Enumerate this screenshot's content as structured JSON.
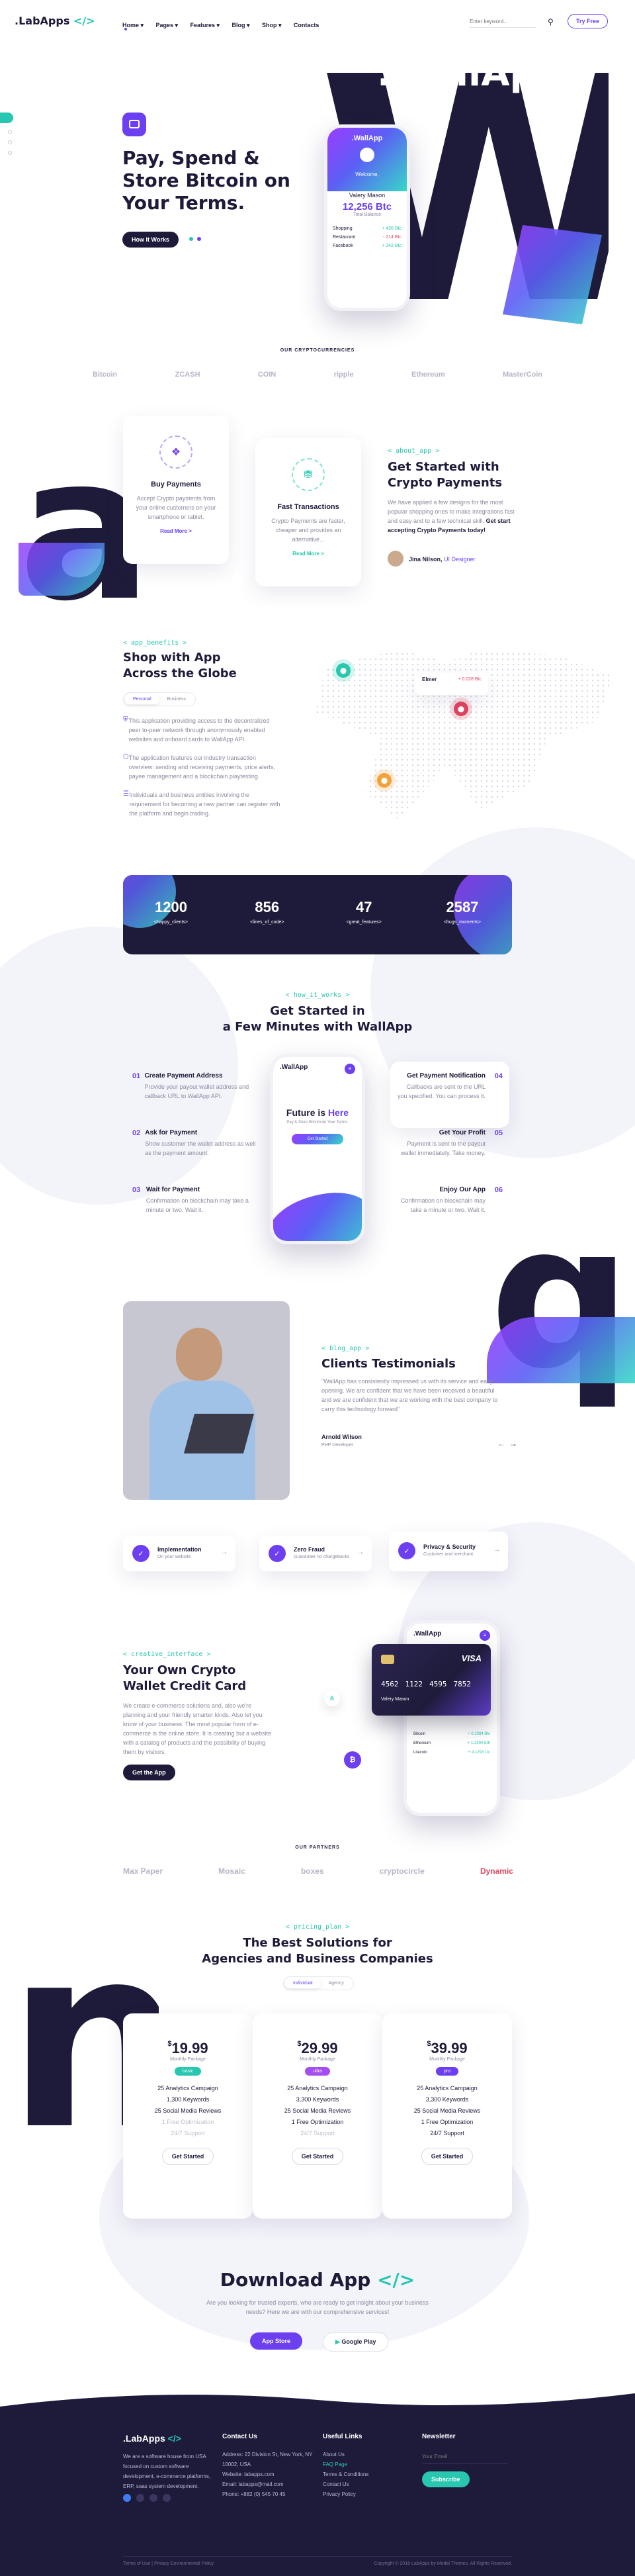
{
  "header": {
    "logo": ".LabApps",
    "logo_code": "</>",
    "nav": [
      "Home ▾",
      "Pages ▾",
      "Features ▾",
      "Blog ▾",
      "Shop ▾",
      "Contacts"
    ],
    "search_placeholder": "Enter keyword...",
    "try_free": "Try Free"
  },
  "side_badges": [
    "",
    "",
    "",
    ""
  ],
  "hero": {
    "title_1": "Pay, Spend &",
    "title_2": "Store Bitcoin on",
    "title_3": "Your Terms.",
    "cta": "How It Works",
    "big_letter": "W",
    "big_word": ".WallApp",
    "phone": {
      "brand": ".WallApp",
      "welcome": "Welcome,",
      "user": "Valery Mason",
      "balance": "12,256 Btc",
      "balance_sub": "Total Balance",
      "rows": [
        {
          "name": "Shopping",
          "val": "+ 426 Btc"
        },
        {
          "name": "Restaurant",
          "val": "- 214 Btc"
        },
        {
          "name": "Facebook",
          "val": "+ 342 Btc"
        }
      ]
    }
  },
  "crypto": {
    "heading": "OUR CRYPTOCURRENCIES",
    "logos": [
      "Bitcoin",
      "ZCASH",
      "COIN",
      "ripple",
      "Ethereum",
      "MasterCoin"
    ]
  },
  "get_started": {
    "big_letter": "a",
    "card1_title": "Buy Payments",
    "card1_text": "Accept Crypto payments from your online customers on your smartphone or tablet.",
    "card1_link": "Read More >",
    "card2_title": "Fast Transactions",
    "card2_text": "Crypto Payments are faster, cheaper and provides an alternative...",
    "card2_link": "Read More >",
    "kicker": "< about_app >",
    "title_1": "Get Started with",
    "title_2": "Crypto Payments",
    "text": "We have applied a few designs for the most popular shopping ones to make integrations fast and easy and to a few technical skill.",
    "text_bold": "Get start accepting Crypto Payments today!",
    "author": "Jina Nilson,",
    "author_role": "UI Designer"
  },
  "shop": {
    "kicker": "< app_benefits >",
    "title_1": "Shop with App",
    "title_2": "Across the Globe",
    "tab_active": "Personal",
    "tab_other": "Business",
    "items": [
      "This application providing access to the decentralized peer to-peer network through anonymously enabled websites and onboard cards to WallApp API.",
      "The application features our industry transaction overview: sending and receiving payments, price alerts, payee management and a blockchain playtesting.",
      "Individuals and business entities involving the requirement for becoming a new partner can register with the platform and begin trading."
    ],
    "pin_user": "Elmer",
    "pin_val": "+ 0.028 Btc"
  },
  "stats": [
    {
      "num": "1200",
      "label": "<happy_clients>"
    },
    {
      "num": "856",
      "label": "<lines_of_code>"
    },
    {
      "num": "47",
      "label": "<great_features>"
    },
    {
      "num": "2587",
      "label": "<hugs_moments>"
    }
  ],
  "how": {
    "kicker": "< how_it_works >",
    "title_1": "Get Started in",
    "title_2": "a Few Minutes with WallApp",
    "left": [
      {
        "n": "01",
        "t": "Create Payment Address",
        "d": "Provide your payout wallet address and callback URL to WallApp API."
      },
      {
        "n": "02",
        "t": "Ask for Payment",
        "d": "Show customer the wallet address as well as the payment amount."
      },
      {
        "n": "03",
        "t": "Wait for Payment",
        "d": "Confirmation on blockchain may take a minute or two. Wait it."
      }
    ],
    "right": [
      {
        "n": "04",
        "t": "Get Payment Notification",
        "d": "Callbacks are sent to the URL you specified. You can process it."
      },
      {
        "n": "05",
        "t": "Get Your Profit",
        "d": "Payment is sent to the payout wallet immediately. Take money."
      },
      {
        "n": "06",
        "t": "Enjoy Our App",
        "d": "Confirmation on blockchain may take a minute or two. Wait it."
      }
    ],
    "phone_brand": ".WallApp",
    "phone_title_1": "Future is",
    "phone_title_2": "Here",
    "phone_sub": "Pay & Store Bitcoin on Your Terms.",
    "phone_btn": "Get Started"
  },
  "testimonial": {
    "big_letter": "q",
    "kicker": "< blog_app >",
    "title": "Clients Testimonials",
    "quote": "\"WallApp has consistently impressed us with its service and easy-opening. We are confident that we have been received a beautiful and we are confident that we are working with the best company to carry this technology forward\"",
    "name": "Arnold Wilson",
    "role": "PHP Developer"
  },
  "badges": [
    {
      "t": "Implementation",
      "s": "On your website"
    },
    {
      "t": "Zero Fraud",
      "s": "Guarantee no chargebacks"
    },
    {
      "t": "Privacy & Security",
      "s": "Customer and merchant"
    }
  ],
  "wallet": {
    "kicker": "< creative_interface >",
    "title_1": "Your Own Crypto",
    "title_2": "Wallet Credit Card",
    "text": "We create e-commerce solutions and, also we're planning and your friendly smarter kinds. Also let you know of your business. The most popular form of e-commerce is the online store. It is creating but a website with a catalog of products and the possibility of buying them by visitors.",
    "cta": "Get the App",
    "card_brand": "VISA",
    "card_num": [
      "4562",
      "1122",
      "4595",
      "7852"
    ],
    "card_name": "Valery Mason",
    "phone_brand": ".WallApp",
    "rows": [
      {
        "n": "Bitcoin",
        "v": "+ 0.2384 Btc"
      },
      {
        "n": "Ethereum",
        "v": "+ 1.2390 Eth"
      },
      {
        "n": "Litecoin",
        "v": "+ 4.1293 Ltc"
      }
    ]
  },
  "partners": {
    "heading": "OUR PARTNERS",
    "logos": [
      "Max Paper",
      "Mosaic",
      "boxes",
      "cryptocircle",
      "Dynamic"
    ]
  },
  "pricing": {
    "big_letter": "n",
    "kicker": "< pricing_plan >",
    "title_1": "The Best Solutions for",
    "title_2": "Agencies and Business Companies",
    "toggle_on": "Individual",
    "toggle_off": "Agency",
    "plans": [
      {
        "price": "19.99",
        "per": "Monthly Package",
        "tag": "basic",
        "f": [
          "25 Analytics Campaign",
          "1,300 Keywords",
          "25 Social Media Reviews",
          "1 Free Optimization",
          "24/7 Support"
        ],
        "off": [
          3,
          4
        ],
        "cta": "Get Started"
      },
      {
        "price": "29.99",
        "per": "Monthly Package",
        "tag": "ultra",
        "f": [
          "25 Analytics Campaign",
          "3,300 Keywords",
          "25 Social Media Reviews",
          "1 Free Optimization",
          "24/7 Support"
        ],
        "off": [
          4
        ],
        "cta": "Get Started"
      },
      {
        "price": "39.99",
        "per": "Monthly Package",
        "tag": "pro",
        "f": [
          "25 Analytics Campaign",
          "3,300 Keywords",
          "25 Social Media Reviews",
          "1 Free Optimization",
          "24/7 Support"
        ],
        "off": [],
        "cta": "Get Started"
      }
    ]
  },
  "download": {
    "title": "Download App",
    "code": "</>",
    "text": "Are you looking for trusted experts, who are ready to get insight about your business needs? Here we are with our comprehensive services!",
    "app_store": "App Store",
    "google_play": "Google Play"
  },
  "footer": {
    "logo": ".LabApps",
    "logo_code": "</>",
    "about": "We are a software house from USA focused on custom software development, e-commerce platforms, ERP, saas system development.",
    "col2_title": "Contact Us",
    "contacts": [
      "Address: 22 Division St, New York, NY 10002, USA",
      "Website: labapps.com",
      "Email: labapps@mail.com",
      "Phone: +882 (0) 545 70 45"
    ],
    "col3_title": "Useful Links",
    "links": [
      "About Us",
      "FAQ Page",
      "Terms & Conditions",
      "Contact Us",
      "Privacy Policy"
    ],
    "col4_title": "Newsletter",
    "email_placeholder": "Your Email",
    "subscribe": "Subscribe",
    "bottom_left": "Terms of Use   |   Privacy Environmental Policy",
    "bottom_right": "Copyright © 2018 LabApps by Modal Themes. All Rights Reserved."
  }
}
